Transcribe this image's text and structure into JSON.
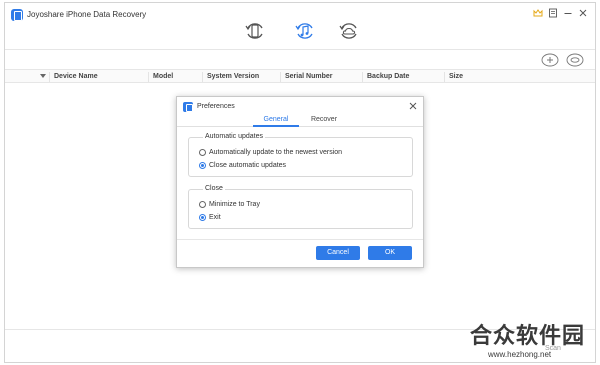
{
  "app": {
    "title": "Joyoshare iPhone Data Recovery"
  },
  "toolbar": {
    "modes": [
      {
        "icon": "ios-device-icon",
        "active": false
      },
      {
        "icon": "itunes-icon",
        "active": true
      },
      {
        "icon": "icloud-icon",
        "active": false
      }
    ],
    "window_controls": [
      "premium-icon",
      "menu-icon",
      "minimize-icon",
      "close-icon"
    ],
    "actions": [
      "add-icon",
      "link-icon"
    ]
  },
  "table": {
    "columns": [
      "Device Name",
      "Model",
      "System Version",
      "Serial Number",
      "Backup Date",
      "Size"
    ]
  },
  "dialog": {
    "title": "Preferences",
    "tabs": [
      {
        "label": "General",
        "active": true
      },
      {
        "label": "Recover",
        "active": false
      }
    ],
    "groups": [
      {
        "legend": "Automatic updates",
        "options": [
          {
            "label": "Automatically update to the newest version",
            "checked": false
          },
          {
            "label": "Close automatic updates",
            "checked": true
          }
        ]
      },
      {
        "legend": "Close",
        "options": [
          {
            "label": "Minimize to Tray",
            "checked": false
          },
          {
            "label": "Exit",
            "checked": true
          }
        ]
      }
    ],
    "cancel_label": "Cancel",
    "ok_label": "OK"
  },
  "footer": {
    "scan_label": "Scan"
  },
  "watermark": {
    "main": "合众软件园",
    "sub": "www.hezhong.net"
  },
  "colors": {
    "accent": "#2f7be8",
    "border": "#d4d4d4"
  }
}
